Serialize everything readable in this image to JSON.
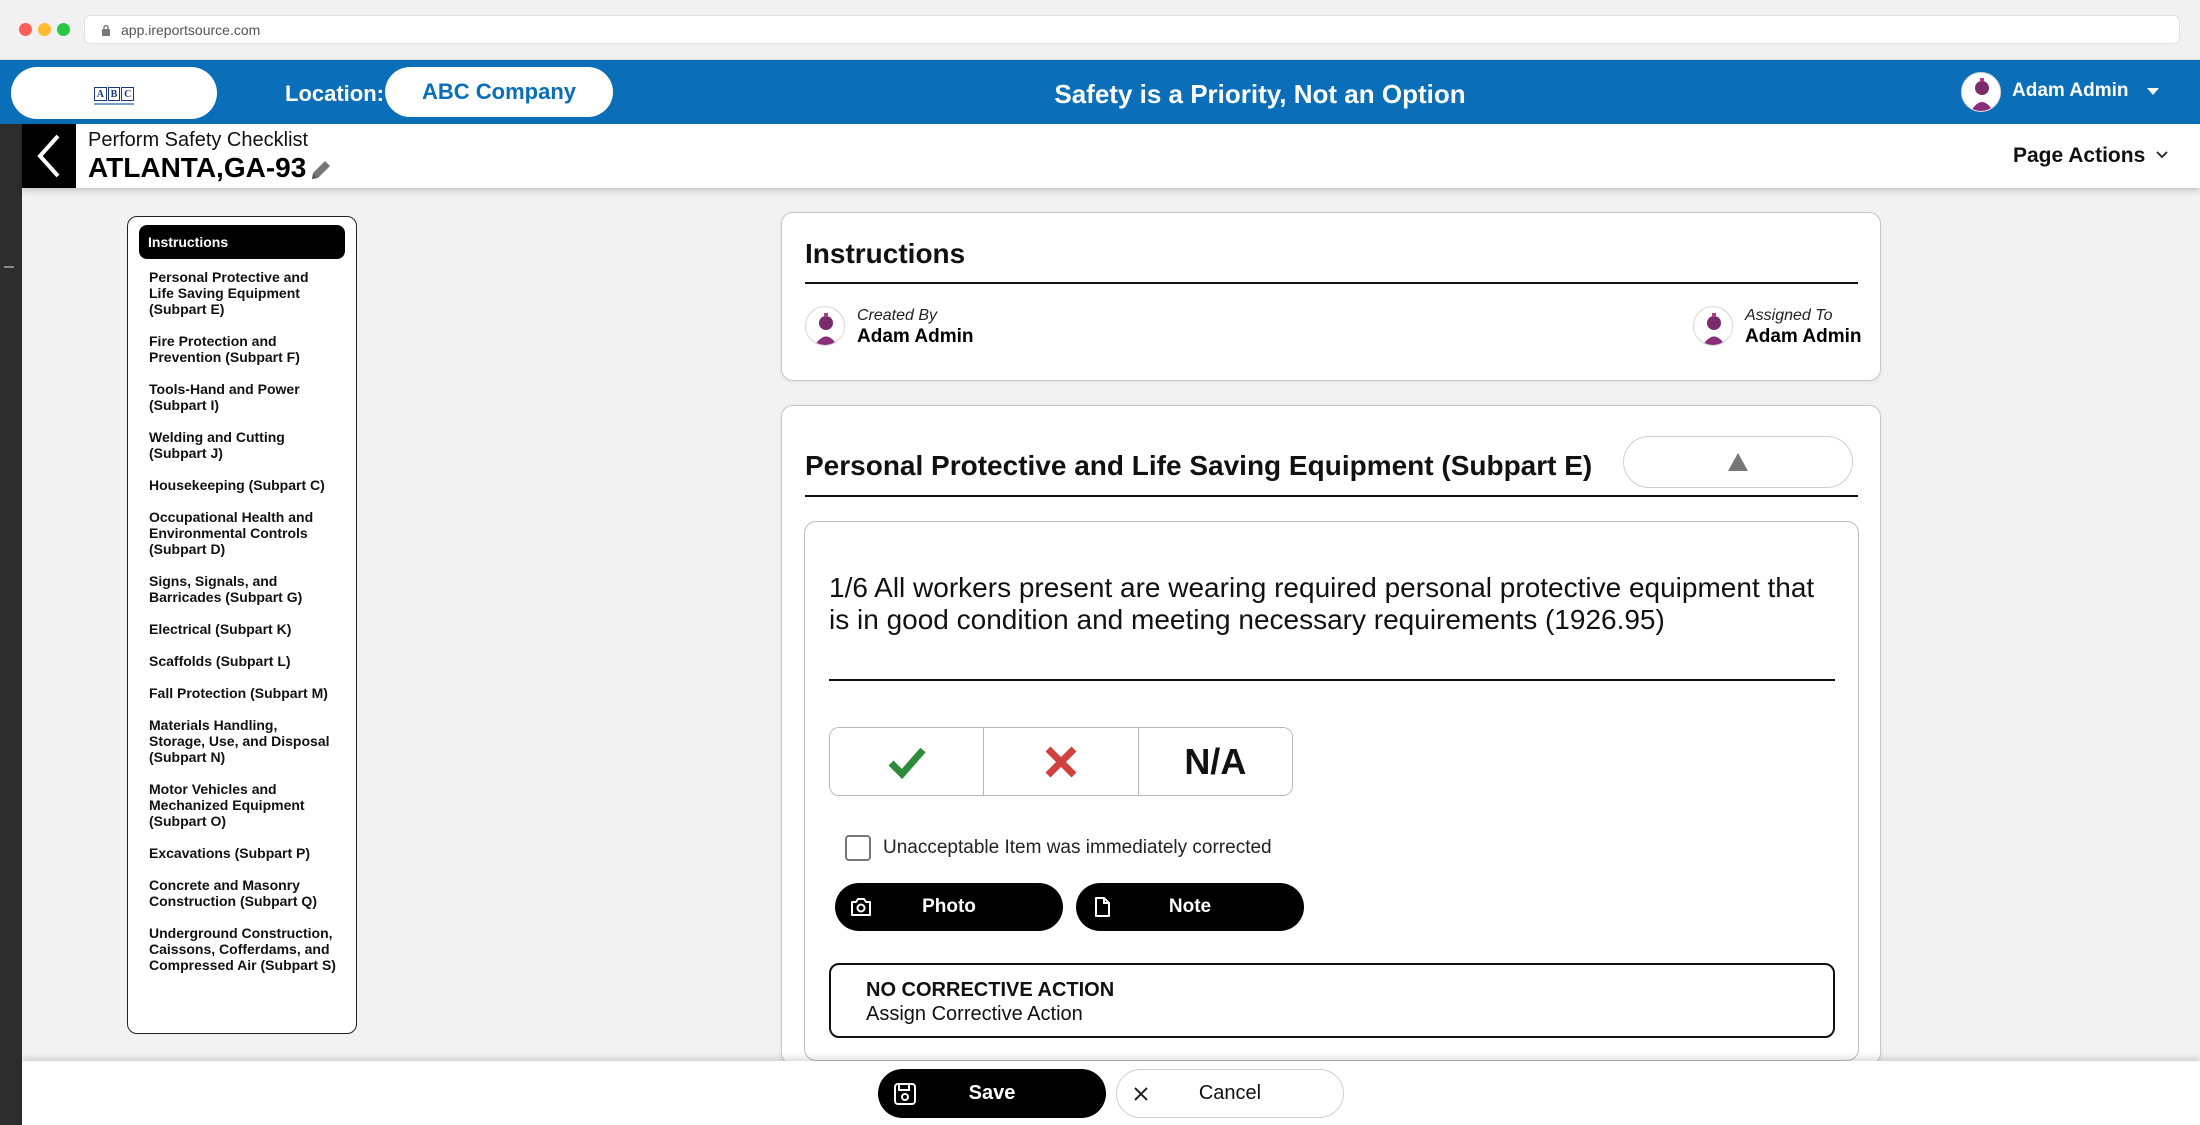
{
  "browser": {
    "url": "app.ireportsource.com"
  },
  "header": {
    "logo_letters": [
      "A",
      "B",
      "C"
    ],
    "location_label": "Location:",
    "location_value": "ABC Company",
    "slogan": "Safety is a Priority, Not an Option",
    "user_name": "Adam Admin",
    "brand_color": "#0a6eb8"
  },
  "subheader": {
    "subtitle": "Perform Safety Checklist",
    "title": "ATLANTA,GA-93",
    "page_actions": "Page Actions"
  },
  "sidebar": {
    "active": "Instructions",
    "items": [
      "Personal Protective and Life Saving Equipment (Subpart E)",
      "Fire Protection and Prevention (Subpart F)",
      "Tools-Hand and Power (Subpart I)",
      "Welding and Cutting (Subpart J)",
      "Housekeeping (Subpart C)",
      "Occupational Health and Environmental Controls (Subpart D)",
      "Signs, Signals, and Barricades (Subpart G)",
      "Electrical (Subpart K)",
      "Scaffolds (Subpart L)",
      "Fall Protection (Subpart M)",
      "Materials Handling, Storage, Use, and Disposal (Subpart N)",
      "Motor Vehicles and Mechanized Equipment (Subpart O)",
      "Excavations (Subpart P)",
      "Concrete and Masonry Construction (Subpart Q)",
      "Underground Construction, Caissons, Cofferdams, and Compressed Air (Subpart S)"
    ]
  },
  "instructions": {
    "title": "Instructions",
    "created_by_label": "Created By",
    "created_by": "Adam Admin",
    "assigned_to_label": "Assigned To",
    "assigned_to": "Adam Admin"
  },
  "section": {
    "title": "Personal Protective and Life Saving Equipment (Subpart E)",
    "question": "1/6 All workers present are wearing required personal protective equipment that is in good condition and meeting necessary requirements (1926.95)",
    "answer_na": "N/A",
    "checkbox_label": "Unacceptable Item was immediately corrected",
    "photo_label": "Photo",
    "note_label": "Note",
    "corrective_title": "NO CORRECTIVE ACTION",
    "corrective_sub": "Assign Corrective Action",
    "pass_color": "#2e8b3a",
    "fail_color": "#d0403e"
  },
  "footer": {
    "save_label": "Save",
    "cancel_label": "Cancel"
  }
}
